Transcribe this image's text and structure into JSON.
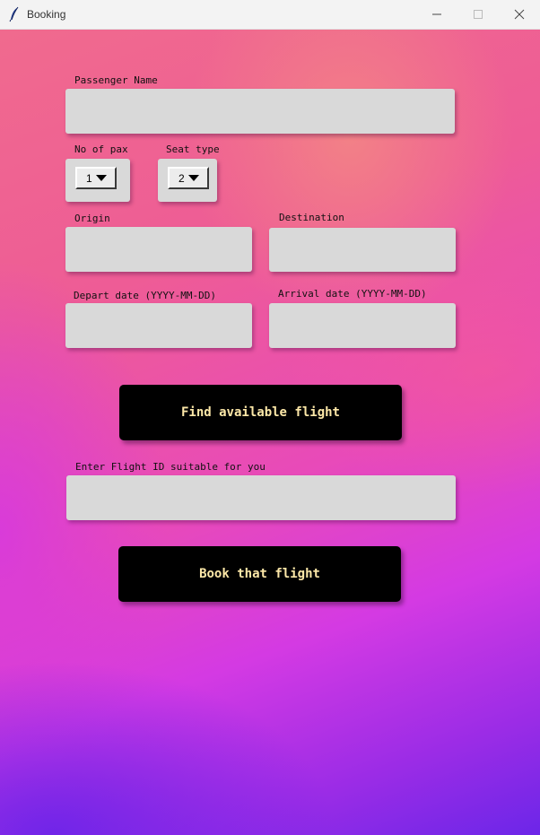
{
  "window": {
    "title": "Booking",
    "app_icon": "feather-icon",
    "controls": [
      "minimize-icon",
      "maximize-icon",
      "close-icon"
    ]
  },
  "form": {
    "passenger_name": {
      "label": "Passenger Name",
      "value": ""
    },
    "pax": {
      "label": "No of pax",
      "selected": "1"
    },
    "seat_type": {
      "label": "Seat type",
      "selected": "2"
    },
    "origin": {
      "label": "Origin",
      "value": ""
    },
    "destination": {
      "label": "Destination",
      "value": ""
    },
    "depart_date": {
      "label": "Depart date (YYYY-MM-DD)",
      "value": ""
    },
    "arrival_date": {
      "label": "Arrival date (YYYY-MM-DD)",
      "value": ""
    },
    "find_button": "Find available flight",
    "flight_id": {
      "label": "Enter Flight ID suitable for you",
      "value": ""
    },
    "book_button": "Book that flight"
  },
  "colors": {
    "entry_bg": "#d9d9d9",
    "button_bg": "#000000",
    "button_text": "#fde8a8"
  }
}
